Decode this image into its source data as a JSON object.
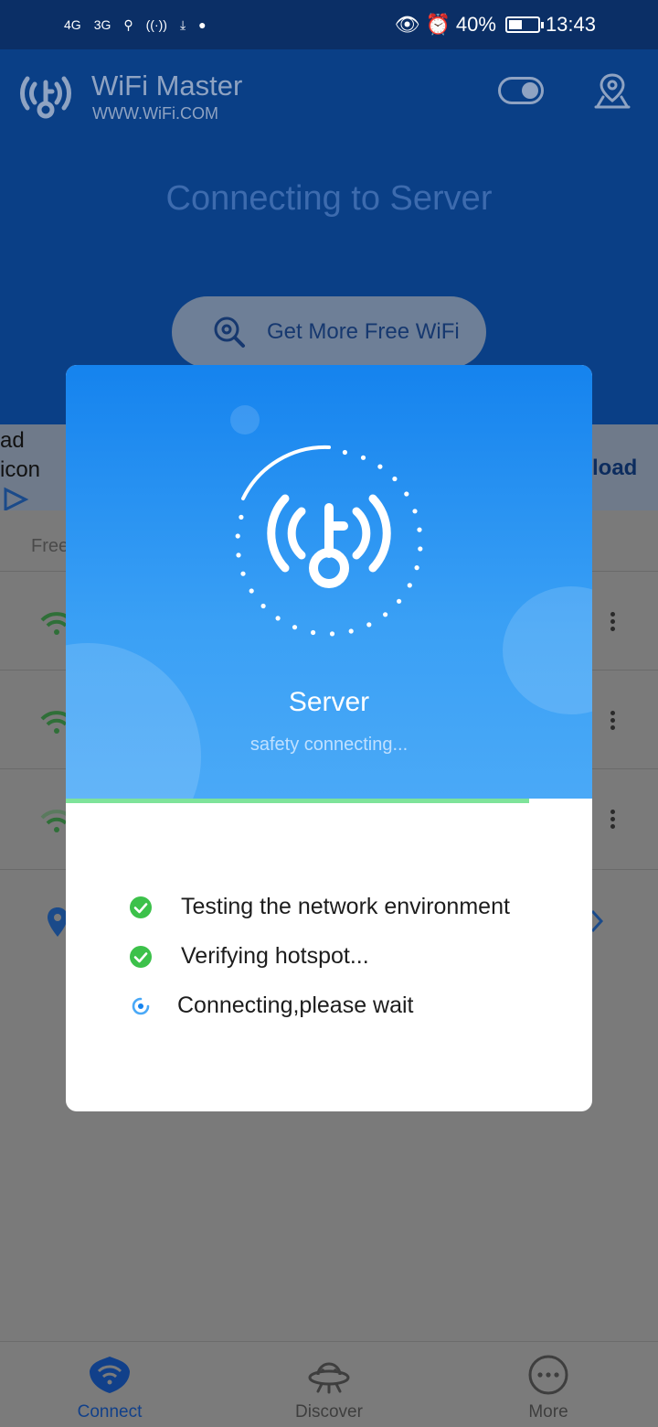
{
  "status_bar": {
    "network_1": "4G",
    "network_2": "3G",
    "battery": "40%",
    "time": "13:43"
  },
  "header": {
    "app_name": "WiFi Master",
    "app_url": "WWW.WiFi.COM",
    "connecting_text": "Connecting to Server",
    "get_wifi_label": "Get More Free WiFi"
  },
  "ad": {
    "alt_text": "ad icon",
    "action_partial": "load"
  },
  "list": {
    "section_label_partial": "Free"
  },
  "dialog": {
    "title": "Server",
    "subtitle": "safety connecting...",
    "progress": 0.88,
    "steps": [
      {
        "label": "Testing the network environment",
        "state": "done"
      },
      {
        "label": "Verifying hotspot...",
        "state": "done"
      },
      {
        "label": "Connecting,please wait",
        "state": "loading"
      }
    ]
  },
  "bottom_nav": [
    {
      "label": "Connect",
      "icon": "wifi-shield-icon",
      "active": true
    },
    {
      "label": "Discover",
      "icon": "ufo-icon",
      "active": false
    },
    {
      "label": "More",
      "icon": "more-circle-icon",
      "active": false
    }
  ],
  "colors": {
    "accent": "#1583ee",
    "success": "#3cc14a",
    "progress": "#7ee39a",
    "overlay_header": "#0a3f86"
  }
}
